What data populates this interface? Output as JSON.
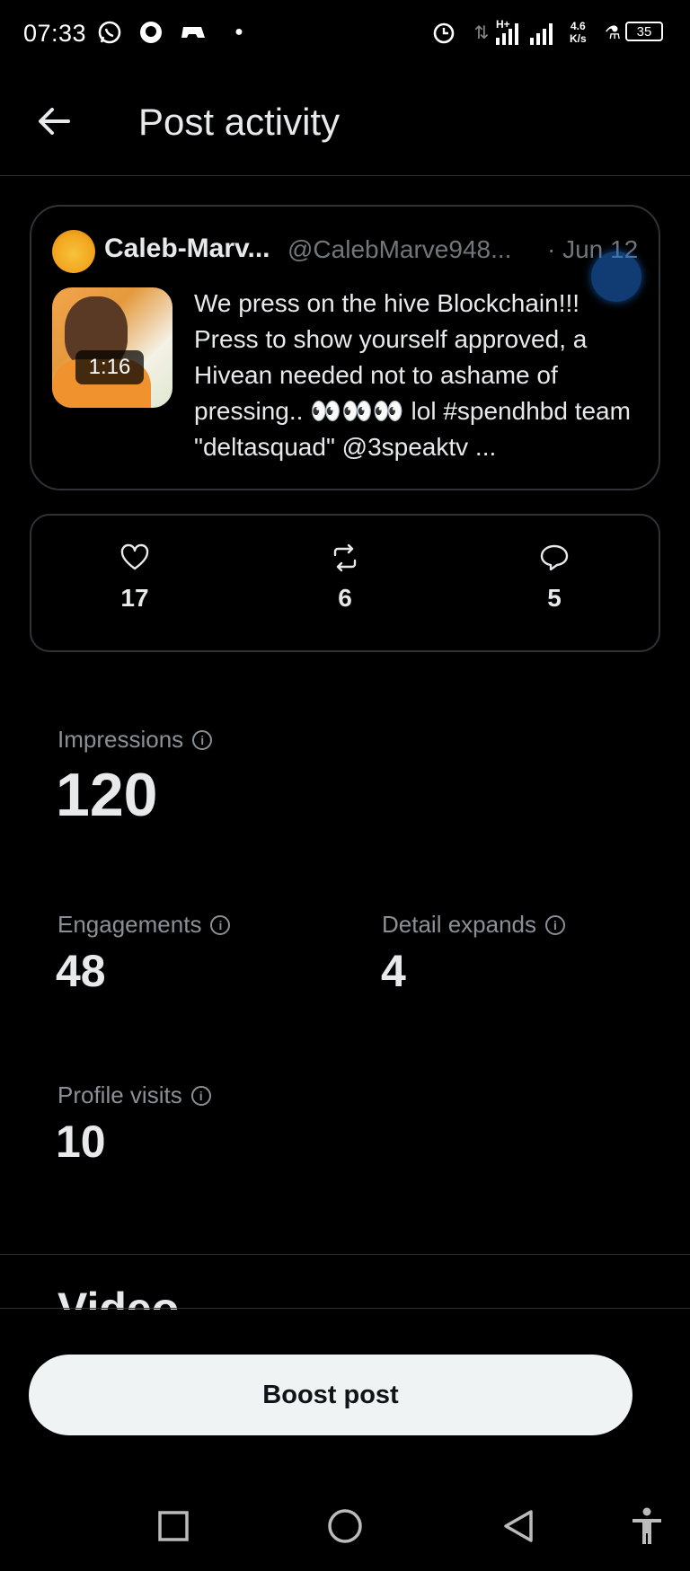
{
  "status_bar": {
    "time": "07:33",
    "network_speed_value": "4.6",
    "network_speed_unit": "K/s",
    "network_type": "H+",
    "battery": "35",
    "icons": [
      "whatsapp-icon",
      "chat-icon",
      "game-icon",
      "dot-icon",
      "alarm-icon",
      "data-arrows-icon",
      "signal-icon",
      "signal-icon",
      "lab-icon",
      "battery-icon"
    ]
  },
  "header": {
    "title": "Post activity",
    "back_icon": "arrow-left-icon"
  },
  "post": {
    "author_name": "Caleb-Marv...",
    "author_handle": "@CalebMarve948...",
    "date": "· Jun 12",
    "duration": "1:16",
    "text": "We press on the hive Blockchain!!! Press to show yourself approved, a Hivean needed not to ashame of pressing.. 👀👀👀 lol  #spendhbd team \"deltasquad\" @3speaktv ..."
  },
  "engagement": {
    "likes": "17",
    "reposts": "6",
    "replies": "5"
  },
  "stats": {
    "impressions_label": "Impressions",
    "impressions_value": "120",
    "engagements_label": "Engagements",
    "engagements_value": "48",
    "detail_expands_label": "Detail expands",
    "detail_expands_value": "4",
    "profile_visits_label": "Profile visits",
    "profile_visits_value": "10"
  },
  "video_section": {
    "heading": "Video"
  },
  "boost": {
    "label": "Boost post"
  },
  "colors": {
    "background": "#000000",
    "text": "#e7e9ea",
    "muted": "#71767b",
    "border": "#2f3336",
    "button": "#eff3f4"
  }
}
